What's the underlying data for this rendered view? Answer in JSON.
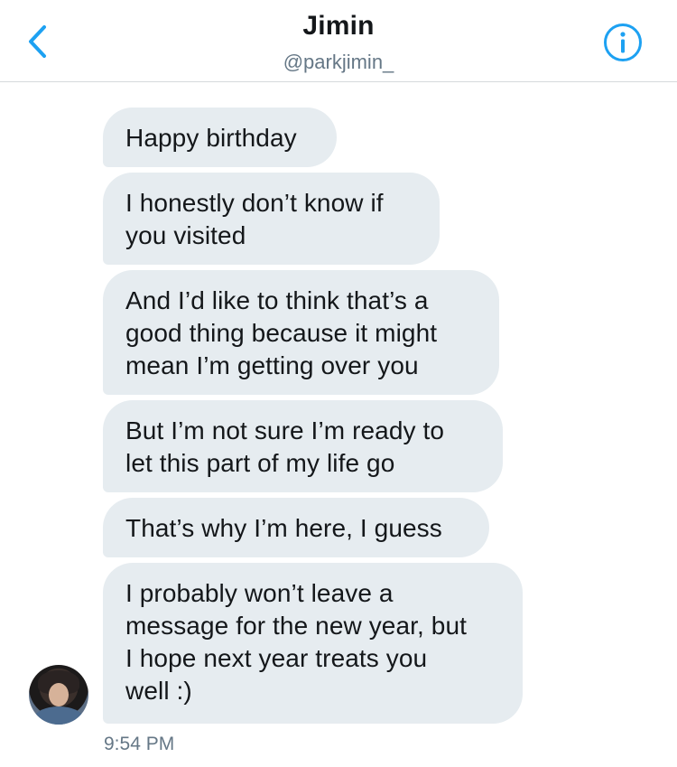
{
  "header": {
    "back_icon": "chevron-left-icon",
    "title": "Jimin",
    "handle": "@parkjimin_",
    "info_icon": "info-circle-icon",
    "accent_color": "#1da1f2"
  },
  "messages": [
    {
      "text": "Happy birthday"
    },
    {
      "text": "I honestly don’t know if\nyou visited"
    },
    {
      "text": "And I’d like to think that’s a\ngood thing because it might\nmean I’m getting over you"
    },
    {
      "text": "But I’m not sure I’m ready to\nlet this part of my life go"
    },
    {
      "text": "That’s why I’m here, I guess"
    },
    {
      "text": "I probably won’t leave a\nmessage for the new year, but\nI hope next year treats you\nwell :)"
    }
  ],
  "last_message_time": "9:54 PM",
  "colors": {
    "bubble_bg": "#e6ecf0",
    "text": "#14171a",
    "secondary_text": "#657786",
    "divider": "#d6d9dc"
  }
}
